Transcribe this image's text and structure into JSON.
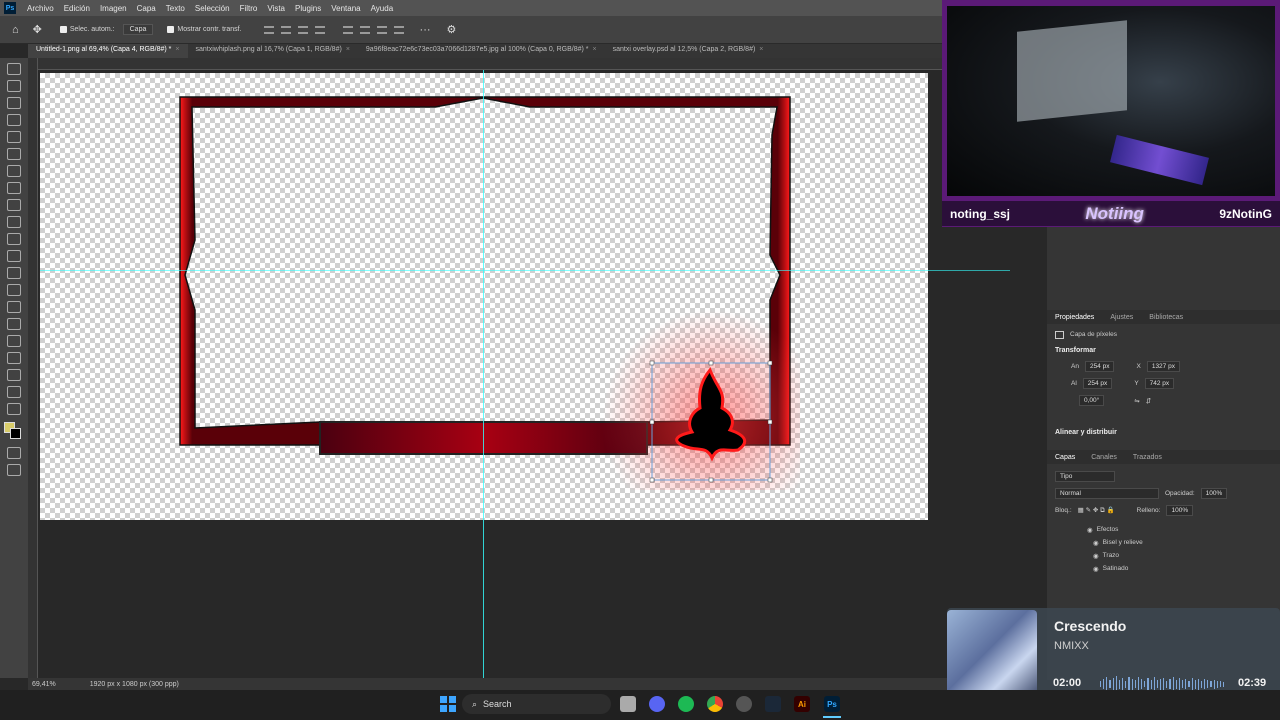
{
  "menubar": {
    "logo": "Ps",
    "items": [
      "Archivo",
      "Edición",
      "Imagen",
      "Capa",
      "Texto",
      "Selección",
      "Filtro",
      "Vista",
      "Plugins",
      "Ventana",
      "Ayuda"
    ]
  },
  "options": {
    "auto_select": "Selec. autom.:",
    "auto_select_value": "Capa",
    "show_transform": "Mostrar contr. transf."
  },
  "tabs": [
    {
      "label": "Untitled-1.png al 69,4% (Capa 4, RGB/8#) *",
      "active": true
    },
    {
      "label": "santxiwhiplash.png al 16,7% (Capa 1, RGB/8#)",
      "active": false
    },
    {
      "label": "9a96f8eac72e6c73ec03a7066d1287e5.jpg al 100% (Capa 0, RGB/8#) *",
      "active": false
    },
    {
      "label": "santxi overlay.psd al 12,5% (Capa 2, RGB/8#)",
      "active": false
    }
  ],
  "status": {
    "zoom": "69,41%",
    "doc_info": "1920 px x 1080 px (300 ppp)"
  },
  "properties": {
    "tabs": [
      "Propiedades",
      "Ajustes",
      "Bibliotecas"
    ],
    "layer_type": "Capa de píxeles",
    "transform_label": "Transformar",
    "width_label": "An",
    "width": "254 px",
    "x_label": "X",
    "x": "1327 px",
    "height_label": "Al",
    "height": "254 px",
    "y_label": "Y",
    "y": "742 px",
    "angle": "0,00°",
    "align_label": "Alinear y distribuir"
  },
  "layers": {
    "tabs": [
      "Capas",
      "Canales",
      "Trazados"
    ],
    "filter": "Tipo",
    "blend_mode": "Normal",
    "opacity_label": "Opacidad:",
    "opacity": "100%",
    "lock_label": "Bloq.:",
    "fill_label": "Relleno:",
    "fill": "100%",
    "effects_label": "Efectos",
    "effects": [
      "Bisel y relieve",
      "Trazo",
      "Satinado"
    ],
    "effects_2": "Efectos"
  },
  "webcam": {
    "handle_left": "noting_ssj",
    "handle_mid": "Notiing",
    "handle_right": "9zNotinG"
  },
  "music": {
    "title": "Crescendo",
    "artist": "NMIXX",
    "time_start": "02:00",
    "time_end": "02:39",
    "progress": 0.36
  },
  "taskbar": {
    "search": "Search",
    "apps": [
      "windows-start",
      "file-explorer",
      "discord",
      "spotify",
      "chrome",
      "steam-alt",
      "steam",
      "illustrator",
      "photoshop"
    ],
    "ai_label": "Ai",
    "ps_label": "Ps"
  },
  "colors": {
    "frame_red": "#c4101a",
    "foreground_swatch": "#d8cc6a",
    "guide": "#33ffff",
    "webcam_border": "#5b1a77"
  }
}
